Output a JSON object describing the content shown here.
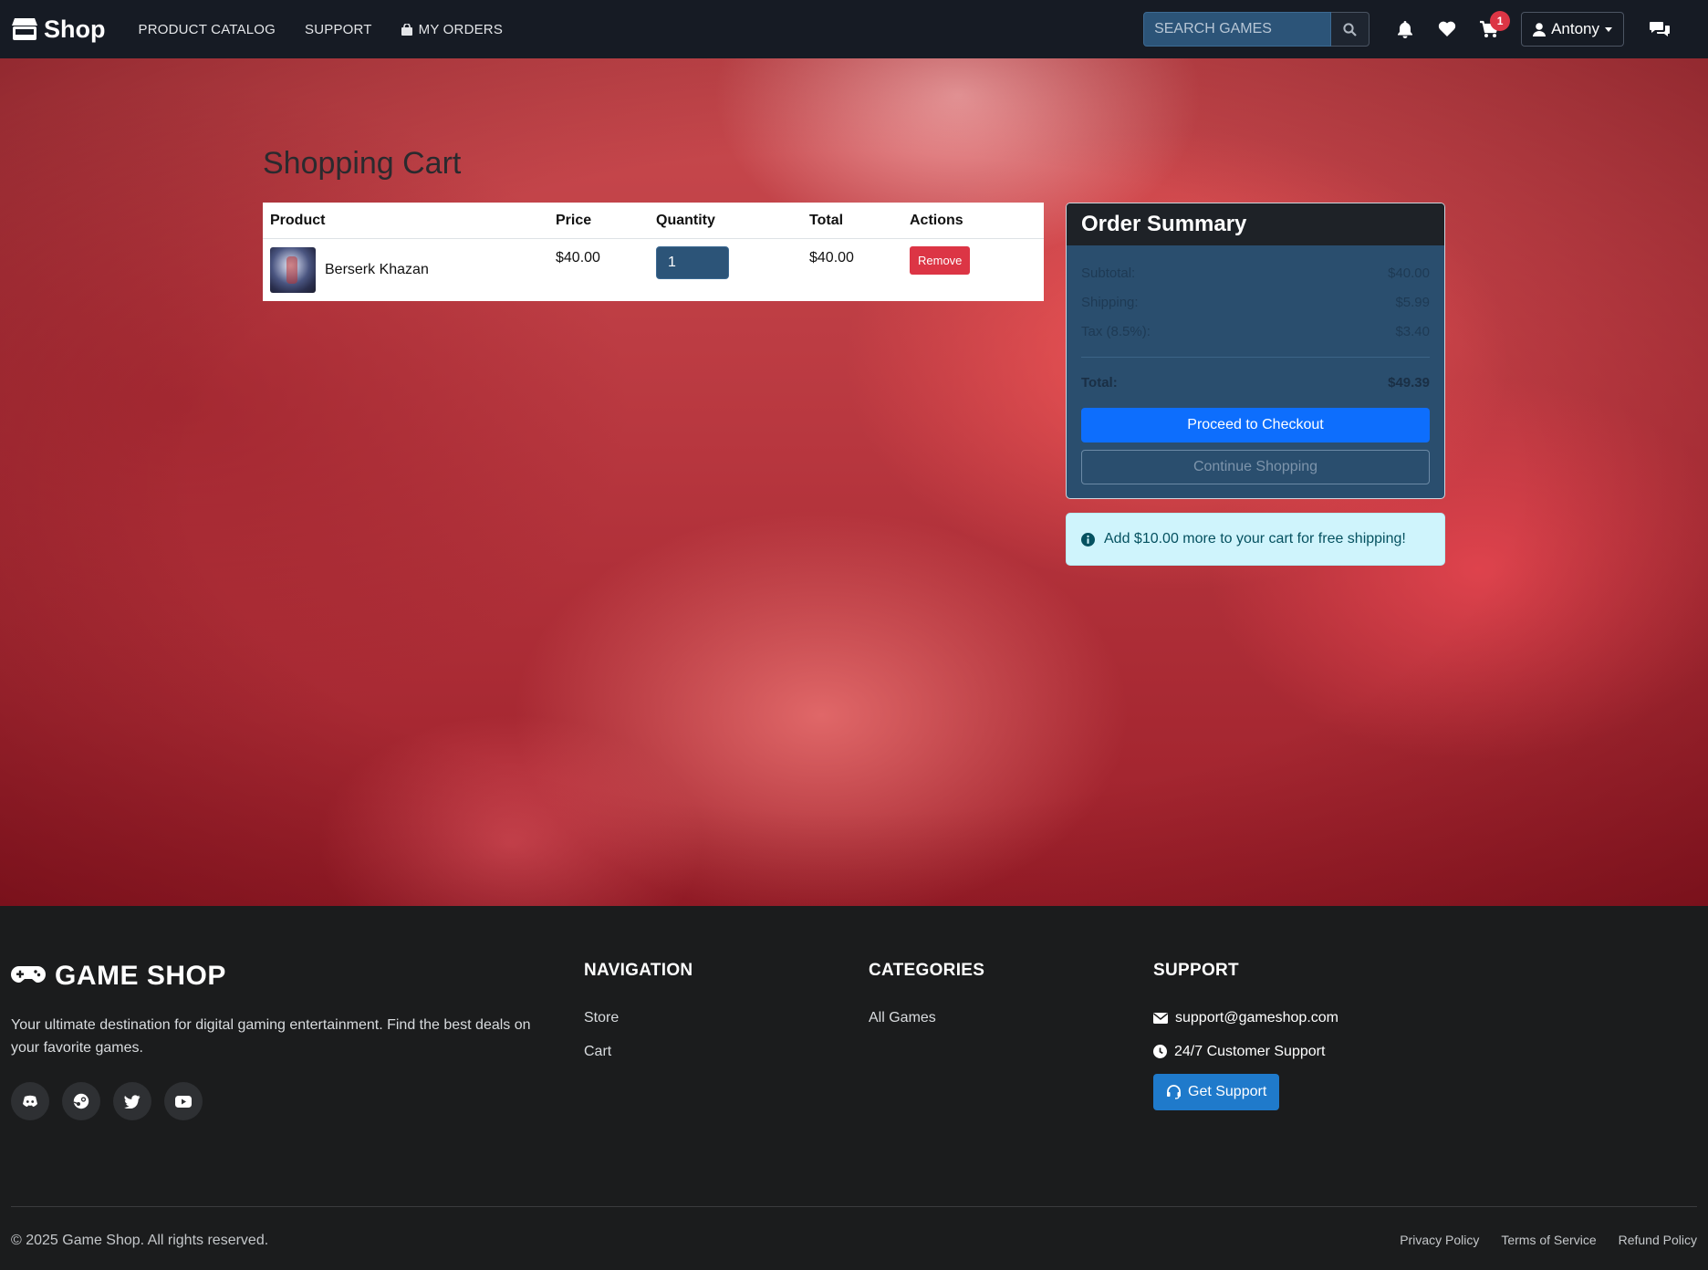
{
  "navbar": {
    "brand": "Shop",
    "links": [
      "PRODUCT CATALOG",
      "SUPPORT",
      "MY ORDERS"
    ],
    "search_placeholder": "SEARCH GAMES",
    "cart_count": "1",
    "user_name": "Antony"
  },
  "page": {
    "title": "Shopping Cart"
  },
  "cart": {
    "headers": [
      "Product",
      "Price",
      "Quantity",
      "Total",
      "Actions"
    ],
    "items": [
      {
        "name": "Berserk Khazan",
        "price": "$40.00",
        "quantity": "1",
        "total": "$40.00",
        "action": "Remove"
      }
    ]
  },
  "summary": {
    "title": "Order Summary",
    "subtotal_label": "Subtotal:",
    "subtotal": "$40.00",
    "shipping_label": "Shipping:",
    "shipping": "$5.99",
    "tax_label": "Tax (8.5%):",
    "tax": "$3.40",
    "total_label": "Total:",
    "total": "$49.39",
    "checkout_label": "Proceed to Checkout",
    "continue_label": "Continue Shopping"
  },
  "alert": {
    "text": "Add $10.00 more to your cart for free shipping!"
  },
  "footer": {
    "brand": "GAME SHOP",
    "description": "Your ultimate destination for digital gaming entertainment. Find the best deals on your favorite games.",
    "navigation": {
      "title": "NAVIGATION",
      "links": [
        "Store",
        "Cart"
      ]
    },
    "categories": {
      "title": "CATEGORIES",
      "links": [
        "All Games"
      ]
    },
    "support": {
      "title": "SUPPORT",
      "email": "support@gameshop.com",
      "hours": "24/7 Customer Support",
      "button": "Get Support"
    },
    "copyright": "© 2025 Game Shop. All rights reserved.",
    "legal": [
      "Privacy Policy",
      "Terms of Service",
      "Refund Policy"
    ]
  },
  "colors": {
    "navbar_bg": "#161b24",
    "search_bg": "#2c5478",
    "badge": "#dc3545",
    "checkout": "#0d6efd",
    "support_btn": "#1f7acb",
    "alert_bg": "#cff4fc",
    "footer_bg": "#1b1c1d"
  },
  "icons": [
    "store-icon",
    "shopping-bag-icon",
    "search-icon",
    "bell-icon",
    "heart-icon",
    "cart-icon",
    "user-icon",
    "chat-icon",
    "info-icon",
    "gamepad-icon",
    "discord-icon",
    "steam-icon",
    "twitter-icon",
    "youtube-icon",
    "envelope-icon",
    "clock-icon",
    "headset-icon"
  ]
}
